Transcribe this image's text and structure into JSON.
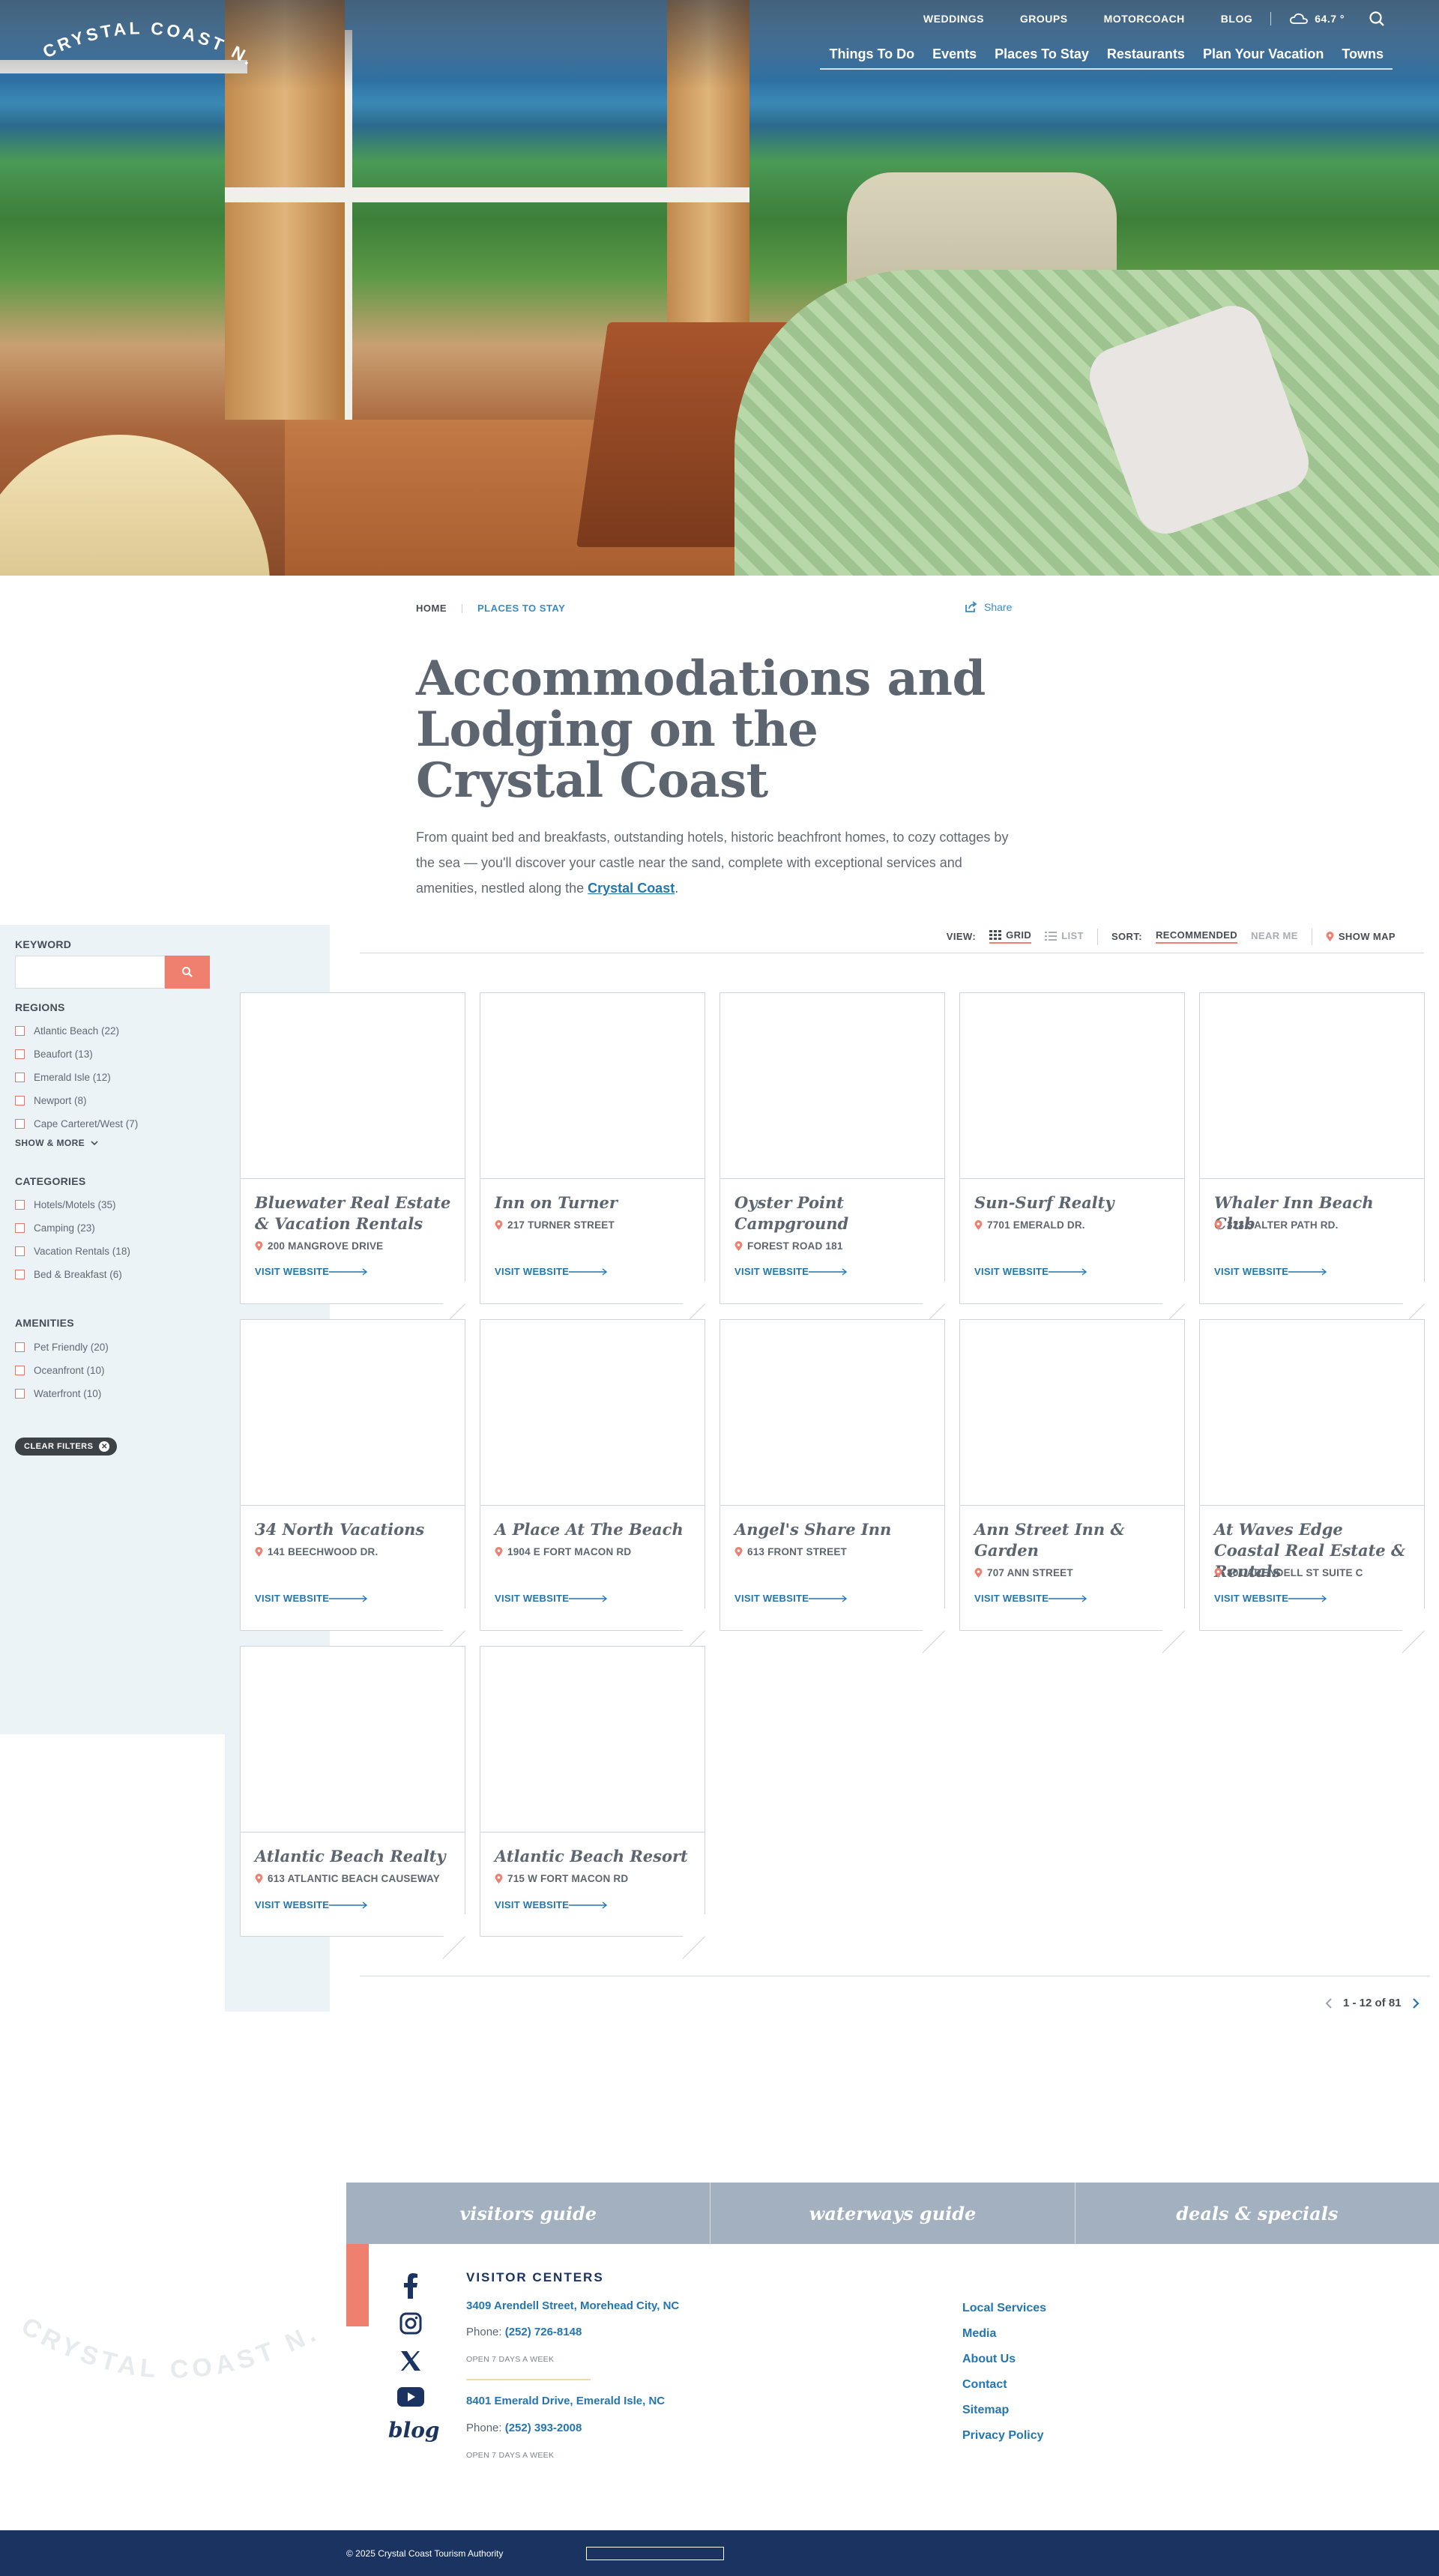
{
  "brand": {
    "logo_text": "CRYSTAL COAST N.C."
  },
  "topnav": {
    "items": [
      "WEDDINGS",
      "GROUPS",
      "MOTORCOACH",
      "BLOG"
    ],
    "temperature": "64.7 °"
  },
  "mainnav": {
    "items": [
      "Things To Do",
      "Events",
      "Places To Stay",
      "Restaurants",
      "Plan Your Vacation",
      "Towns"
    ]
  },
  "breadcrumb": {
    "home": "HOME",
    "current": "PLACES TO STAY"
  },
  "share_label": "Share",
  "page": {
    "title": "Accommodations and Lodging on the Crystal Coast",
    "intro_before": "From quaint bed and breakfasts, outstanding hotels, historic beachfront homes, to cozy cottages by the sea — you'll discover your castle near the sand, complete with exceptional services and amenities, nestled along the ",
    "intro_link": "Crystal Coast",
    "intro_after": "."
  },
  "filters": {
    "keyword_label": "KEYWORD",
    "regions_label": "REGIONS",
    "regions": [
      "Atlantic Beach (22)",
      "Beaufort (13)",
      "Emerald Isle (12)",
      "Newport (8)",
      "Cape Carteret/West (7)"
    ],
    "show_more": "SHOW & MORE",
    "categories_label": "CATEGORIES",
    "categories": [
      "Hotels/Motels (35)",
      "Camping (23)",
      "Vacation Rentals (18)",
      "Bed & Breakfast (6)"
    ],
    "amenities_label": "AMENITIES",
    "amenities": [
      "Pet Friendly (20)",
      "Oceanfront (10)",
      "Waterfront (10)"
    ],
    "clear_label": "CLEAR FILTERS"
  },
  "viewbar": {
    "view_label": "VIEW:",
    "grid": "GRID",
    "list": "LIST",
    "sort_label": "SORT:",
    "recommended": "RECOMMENDED",
    "near_me": "NEAR ME",
    "show_map": "SHOW MAP"
  },
  "visit_label": "VISIT WEBSITE",
  "listings": [
    {
      "name": "Bluewater Real Estate & Vacation Rentals",
      "address": "200 MANGROVE DRIVE"
    },
    {
      "name": "Inn on Turner",
      "address": "217 TURNER STREET"
    },
    {
      "name": "Oyster Point Campground",
      "address": "FOREST ROAD 181"
    },
    {
      "name": "Sun-Surf Realty",
      "address": "7701 EMERALD DR."
    },
    {
      "name": "Whaler Inn Beach Club",
      "address": "323 SALTER PATH RD."
    },
    {
      "name": "34 North Vacations",
      "address": "141 BEECHWOOD DR."
    },
    {
      "name": "A Place At The Beach",
      "address": "1904 E FORT MACON RD"
    },
    {
      "name": "Angel's Share Inn",
      "address": "613 FRONT STREET"
    },
    {
      "name": "Ann Street Inn & Garden",
      "address": "707 ANN STREET"
    },
    {
      "name": "At Waves Edge Coastal Real Estate & Rentals",
      "address": "801 ARENDELL ST SUITE C"
    },
    {
      "name": "Atlantic Beach Realty",
      "address": "613 ATLANTIC BEACH CAUSEWAY"
    },
    {
      "name": "Atlantic Beach Resort",
      "address": "715 W FORT MACON RD"
    }
  ],
  "pagination": {
    "range": "1 - 12 of 81"
  },
  "footer": {
    "bar": [
      "visitors guide",
      "waterways guide",
      "deals & specials"
    ],
    "blog": "blog",
    "visitor_centers_title": "VISITOR CENTERS",
    "centers": [
      {
        "address": "3409 Arendell Street, Morehead City, NC",
        "phone_label": "Phone:",
        "phone": "(252) 726-8148",
        "hours": "OPEN 7 DAYS A WEEK"
      },
      {
        "address": "8401 Emerald Drive, Emerald Isle, NC",
        "phone_label": "Phone:",
        "phone": "(252) 393-2008",
        "hours": "OPEN 7 DAYS A WEEK"
      }
    ],
    "links": [
      "Local Services",
      "Media",
      "About Us",
      "Contact",
      "Sitemap",
      "Privacy Policy"
    ],
    "copyright": "© 2025 Crystal Coast Tourism Authority"
  },
  "colors": {
    "accent": "#ef8070",
    "link": "#2476b0",
    "navy": "#1b3360",
    "sidebar_bg": "#ebf3f7"
  }
}
